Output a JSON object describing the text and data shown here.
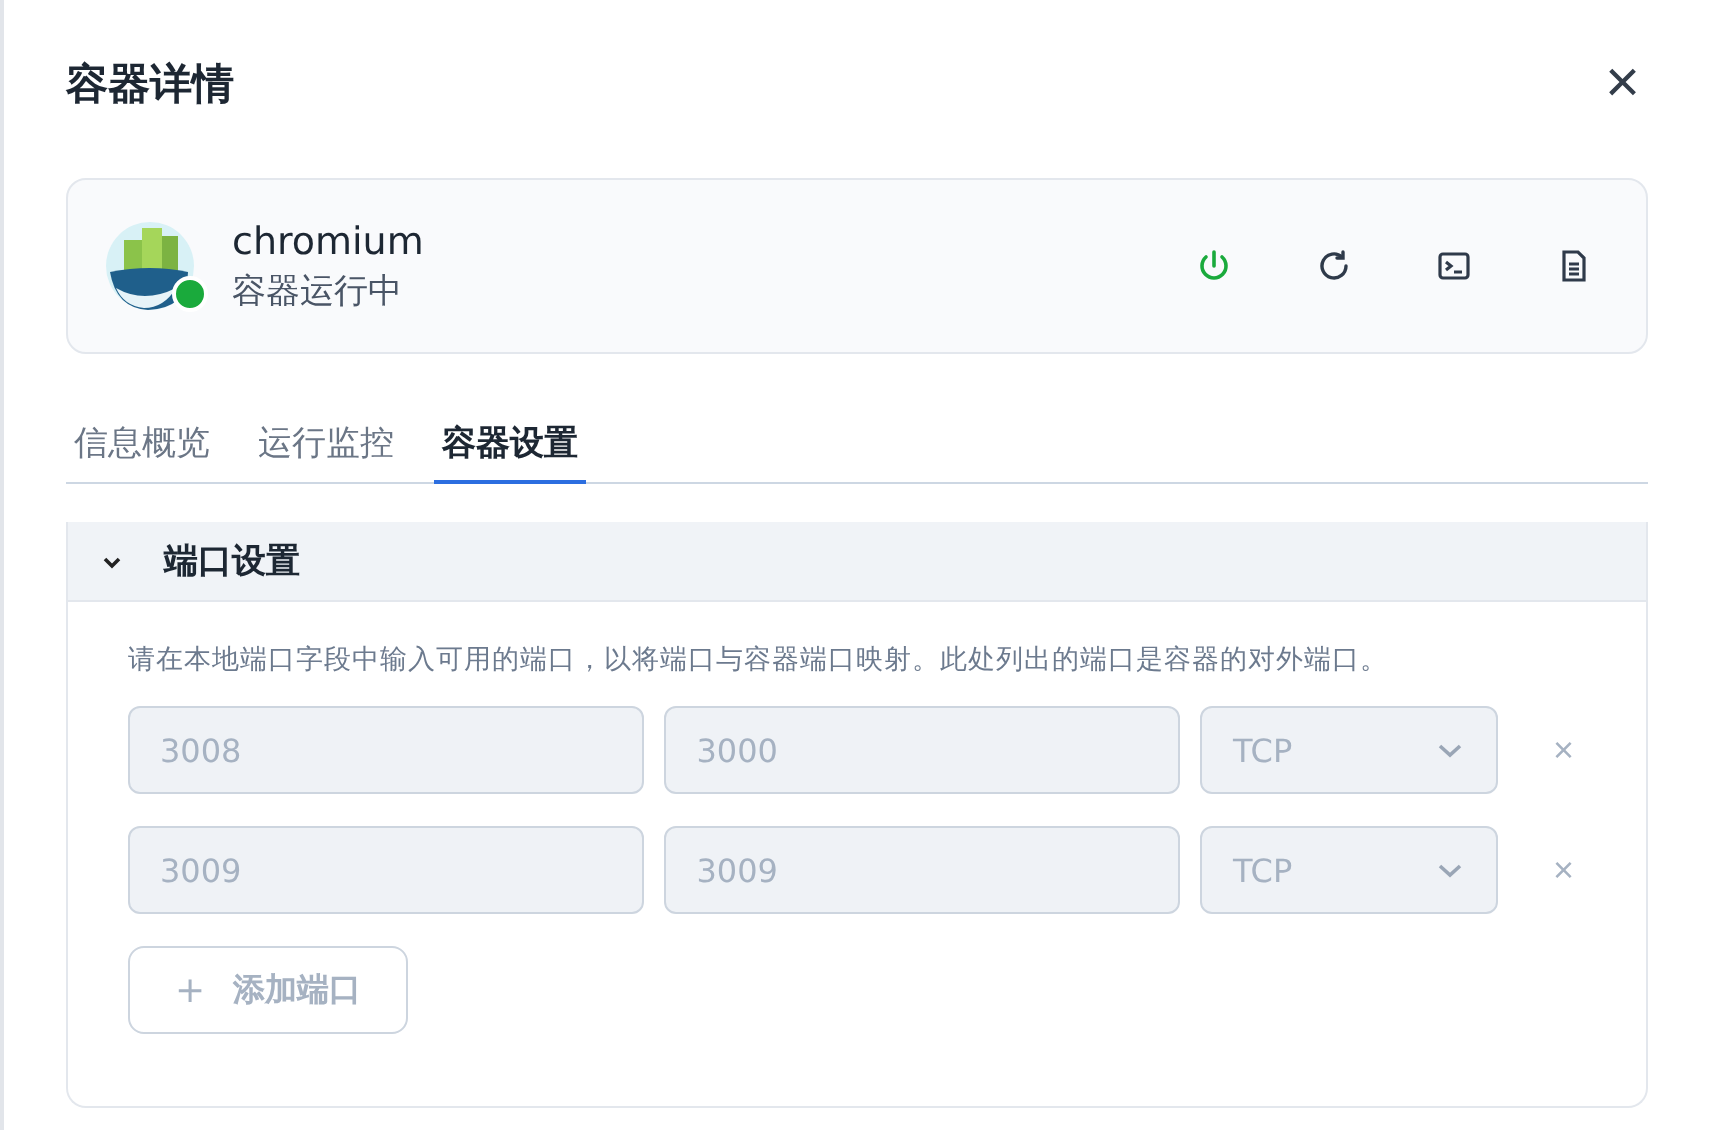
{
  "dialog": {
    "title": "容器详情",
    "close": "×"
  },
  "container": {
    "name": "chromium",
    "status": "容器运行中",
    "running": true
  },
  "actions": [
    {
      "kind": "power"
    },
    {
      "kind": "restart"
    },
    {
      "kind": "terminal"
    },
    {
      "kind": "log"
    }
  ],
  "tabs": [
    {
      "label": "信息概览",
      "selected": false
    },
    {
      "label": "运行监控",
      "selected": false
    },
    {
      "label": "容器设置",
      "selected": true
    }
  ],
  "section": {
    "title": "端口设置",
    "expanded": true,
    "hint": "请在本地端口字段中输入可用的端口，以将端口与容器端口映射。此处列出的端口是容器的对外端口。",
    "ports": [
      {
        "local": "3008",
        "container": "3000",
        "protocol": "TCP",
        "remove": "×",
        "disabled": true
      },
      {
        "local": "3009",
        "container": "3009",
        "protocol": "TCP",
        "remove": "×",
        "disabled": true
      }
    ],
    "add_button": {
      "icon": "+",
      "label": "添加端口",
      "disabled": true
    }
  }
}
